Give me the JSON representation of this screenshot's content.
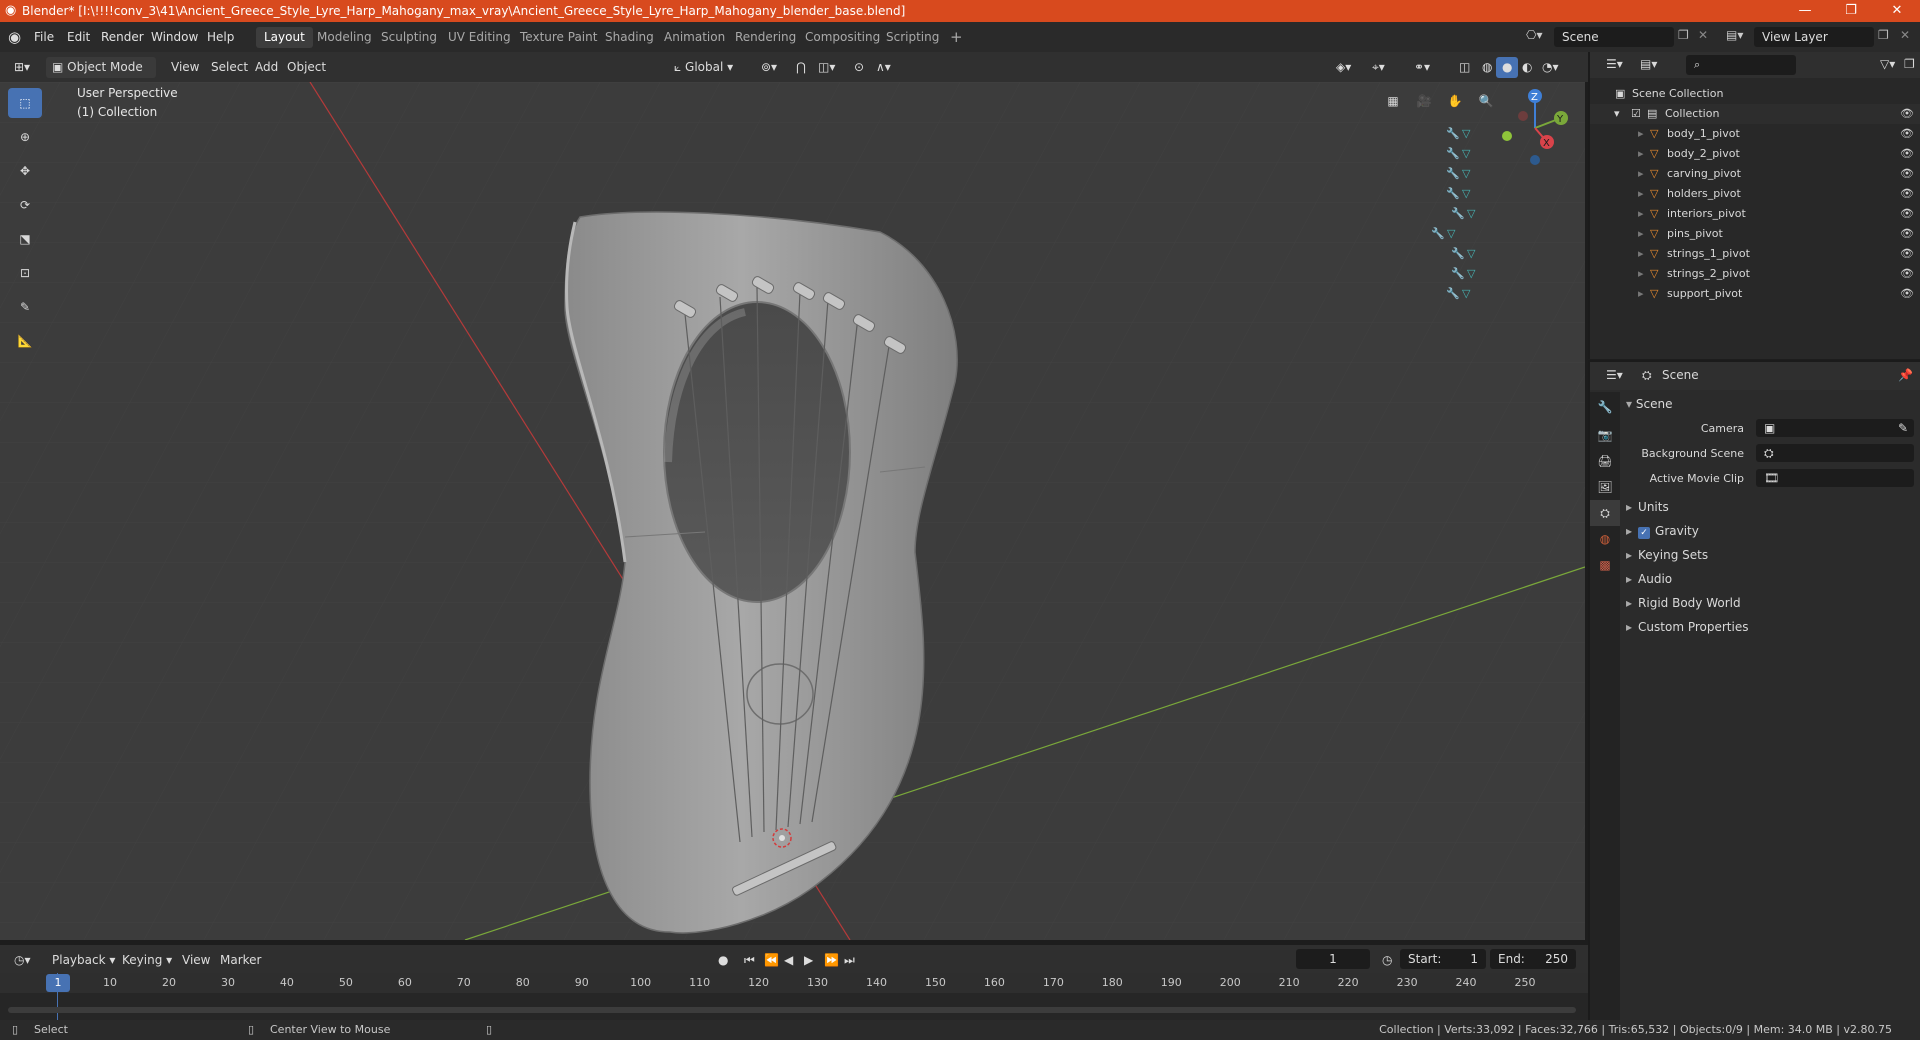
{
  "title": "Blender* [I:\\!!!!conv_3\\41\\Ancient_Greece_Style_Lyre_Harp_Mahogany_max_vray\\Ancient_Greece_Style_Lyre_Harp_Mahogany_blender_base.blend]",
  "menu": [
    "File",
    "Edit",
    "Render",
    "Window",
    "Help"
  ],
  "workspaces": [
    "Layout",
    "Modeling",
    "Sculpting",
    "UV Editing",
    "Texture Paint",
    "Shading",
    "Animation",
    "Rendering",
    "Compositing",
    "Scripting"
  ],
  "active_workspace": "Layout",
  "scene_field": "Scene",
  "view_layer_field": "View Layer",
  "viewport_header": {
    "mode": "Object Mode",
    "view": "View",
    "select": "Select",
    "add": "Add",
    "object": "Object",
    "orientation": "Global"
  },
  "viewport_info": {
    "perspective": "User Perspective",
    "collection": "(1) Collection"
  },
  "gizmo": {
    "z": "Z",
    "y": "Y",
    "x": "X"
  },
  "outliner": {
    "root": "Scene Collection",
    "collection": "Collection",
    "items": [
      "body_1_pivot",
      "body_2_pivot",
      "carving_pivot",
      "holders_pivot",
      "interiors_pivot",
      "pins_pivot",
      "strings_1_pivot",
      "strings_2_pivot",
      "support_pivot"
    ]
  },
  "properties": {
    "header": "Scene",
    "panel": "Scene",
    "camera_label": "Camera",
    "background_label": "Background Scene",
    "movieclip_label": "Active Movie Clip",
    "sections": [
      "Units",
      "Gravity",
      "Keying Sets",
      "Audio",
      "Rigid Body World",
      "Custom Properties"
    ]
  },
  "timeline": {
    "playback": "Playback",
    "keying": "Keying",
    "view": "View",
    "marker": "Marker",
    "current_frame": "1",
    "start_label": "Start:",
    "start": "1",
    "end_label": "End:",
    "end": "250",
    "ticks": [
      "1",
      "10",
      "20",
      "30",
      "40",
      "50",
      "60",
      "70",
      "80",
      "90",
      "100",
      "110",
      "120",
      "130",
      "140",
      "150",
      "160",
      "170",
      "180",
      "190",
      "200",
      "210",
      "220",
      "230",
      "240",
      "250"
    ]
  },
  "status": {
    "select": "Select",
    "center": "Center View to Mouse",
    "stats": "Collection | Verts:33,092 | Faces:32,766 | Tris:65,532 | Objects:0/9 | Mem: 34.0 MB | v2.80.75"
  },
  "colors": {
    "accent": "#4772b3",
    "titlebar": "#d84a1e",
    "x_axis": "#b43a3a",
    "y_axis": "#7aa83a"
  }
}
